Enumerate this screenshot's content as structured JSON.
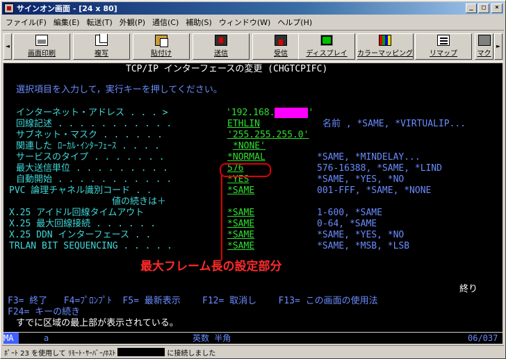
{
  "window": {
    "title": "サインオン画面 - [24 x 80]",
    "minimize_glyph": "_",
    "maximize_glyph": "□",
    "close_glyph": "×"
  },
  "menu": [
    "ファイル(F)",
    "編集(E)",
    "転送(T)",
    "外観(P)",
    "通信(C)",
    "補助(S)",
    "ウィンドウ(W)",
    "ヘルプ(H)"
  ],
  "toolbar": {
    "left_arrow": "◄",
    "right_arrow": "►",
    "buttons": [
      {
        "label": "画面印刷",
        "icon": "print-icon"
      },
      {
        "label": "複写",
        "icon": "copy-icon"
      },
      {
        "label": "貼付け",
        "icon": "paste-icon"
      },
      {
        "label": "送信",
        "icon": "send-icon"
      },
      {
        "label": "受信",
        "icon": "receive-icon"
      },
      {
        "label": "ディスプレイ",
        "icon": "display-icon"
      },
      {
        "label": "カラーマッピング",
        "icon": "color-mapping-icon"
      },
      {
        "label": "リマップ",
        "icon": "remap-icon"
      },
      {
        "label": "マク",
        "icon": "macro-icon"
      }
    ]
  },
  "terminal": {
    "title": "TCP/IP インターフェースの変更 (CHGTCPIFC)",
    "instruction": "選択項目を入力して，実行キーを押してください。",
    "fields": [
      {
        "label": "インターネット・アドレス . . . >",
        "value": "'192.168.",
        "value_end": "'",
        "hint": ""
      },
      {
        "label": "回線記述 . . . . . . . . . . .",
        "value": "ETHLIN",
        "value_end": "",
        "hint": "名前 , *SAME, *VIRTUALIP..."
      },
      {
        "label": "サブネット・マスク . . . . . .",
        "value": "'255.255.255.0'",
        "value_end": "",
        "hint": ""
      },
      {
        "label": "関連した ﾛｰｶﾙ･ｲﾝﾀｰﾌｪｰｽ . . . .",
        "value": "*NONE'",
        "value_end": "",
        "hint": ""
      },
      {
        "label": "サービスのタイプ . . . . . . .",
        "value": "*NORMAL",
        "value_end": "",
        "hint": "*SAME, *MINDELAY..."
      },
      {
        "label": "最大送信単位 . . . . . . . . .",
        "value": "576",
        "value_end": "",
        "hint": "576-16388, *SAME, *LIND"
      },
      {
        "label": "自動開始 . . . . . . . . . . .",
        "value": "*YES",
        "value_end": "",
        "hint": "*SAME, *YES, *NO"
      },
      {
        "label": "PVC 論理チャネル識別コード . .",
        "value": "*SAME",
        "value_end": "",
        "hint": "001-FFF, *SAME, *NONE"
      },
      {
        "label": "値の続きは＋",
        "value": "",
        "value_end": "",
        "hint": ""
      },
      {
        "label": "X.25 アイドル回線タイムアウト",
        "value": "*SAME",
        "value_end": "",
        "hint": "1-600, *SAME"
      },
      {
        "label": "X.25 最大回線接続 . . . . . .",
        "value": "*SAME",
        "value_end": "",
        "hint": "0-64, *SAME"
      },
      {
        "label": "X.25 DDN インターフェース . .",
        "value": "*SAME",
        "value_end": "",
        "hint": "*SAME, *YES, *NO"
      },
      {
        "label": "TRLAN BIT SEQUENCING . . . . .",
        "value": "*SAME",
        "value_end": "",
        "hint": "*SAME, *MSB, *LSB"
      }
    ],
    "annotation": "最大フレーム長の設定部分",
    "more": "終り",
    "fkeys_line1": "F3= 終了   F4=ﾌﾟﾛﾝﾌﾟﾄ  F5= 最新表示    F12= 取消し    F13= この画面の使用法",
    "fkeys_line2": "F24= キーの続き",
    "message": "すでに区域の最上部が表示されている。"
  },
  "oia": {
    "indicator": "MA",
    "mode": "a",
    "input_mode": "英数 半角",
    "cursor": "06/037"
  },
  "statusbar": {
    "text_before": "ﾎﾟｰﾄ 23 を使用して ﾘﾓｰﾄ･ｻｰﾊﾞｰ/ﾎｽﾄ",
    "text_after": "に接続しました"
  },
  "colors": {
    "terminal_bg": "#000000",
    "field_green": "#30e030",
    "text_cyan": "#40d8d8",
    "text_blue": "#6a8cff",
    "annotation_red": "#ff2a2a",
    "redacted_magenta": "#ff00ff",
    "title_gradient_start": "#0a246a"
  }
}
